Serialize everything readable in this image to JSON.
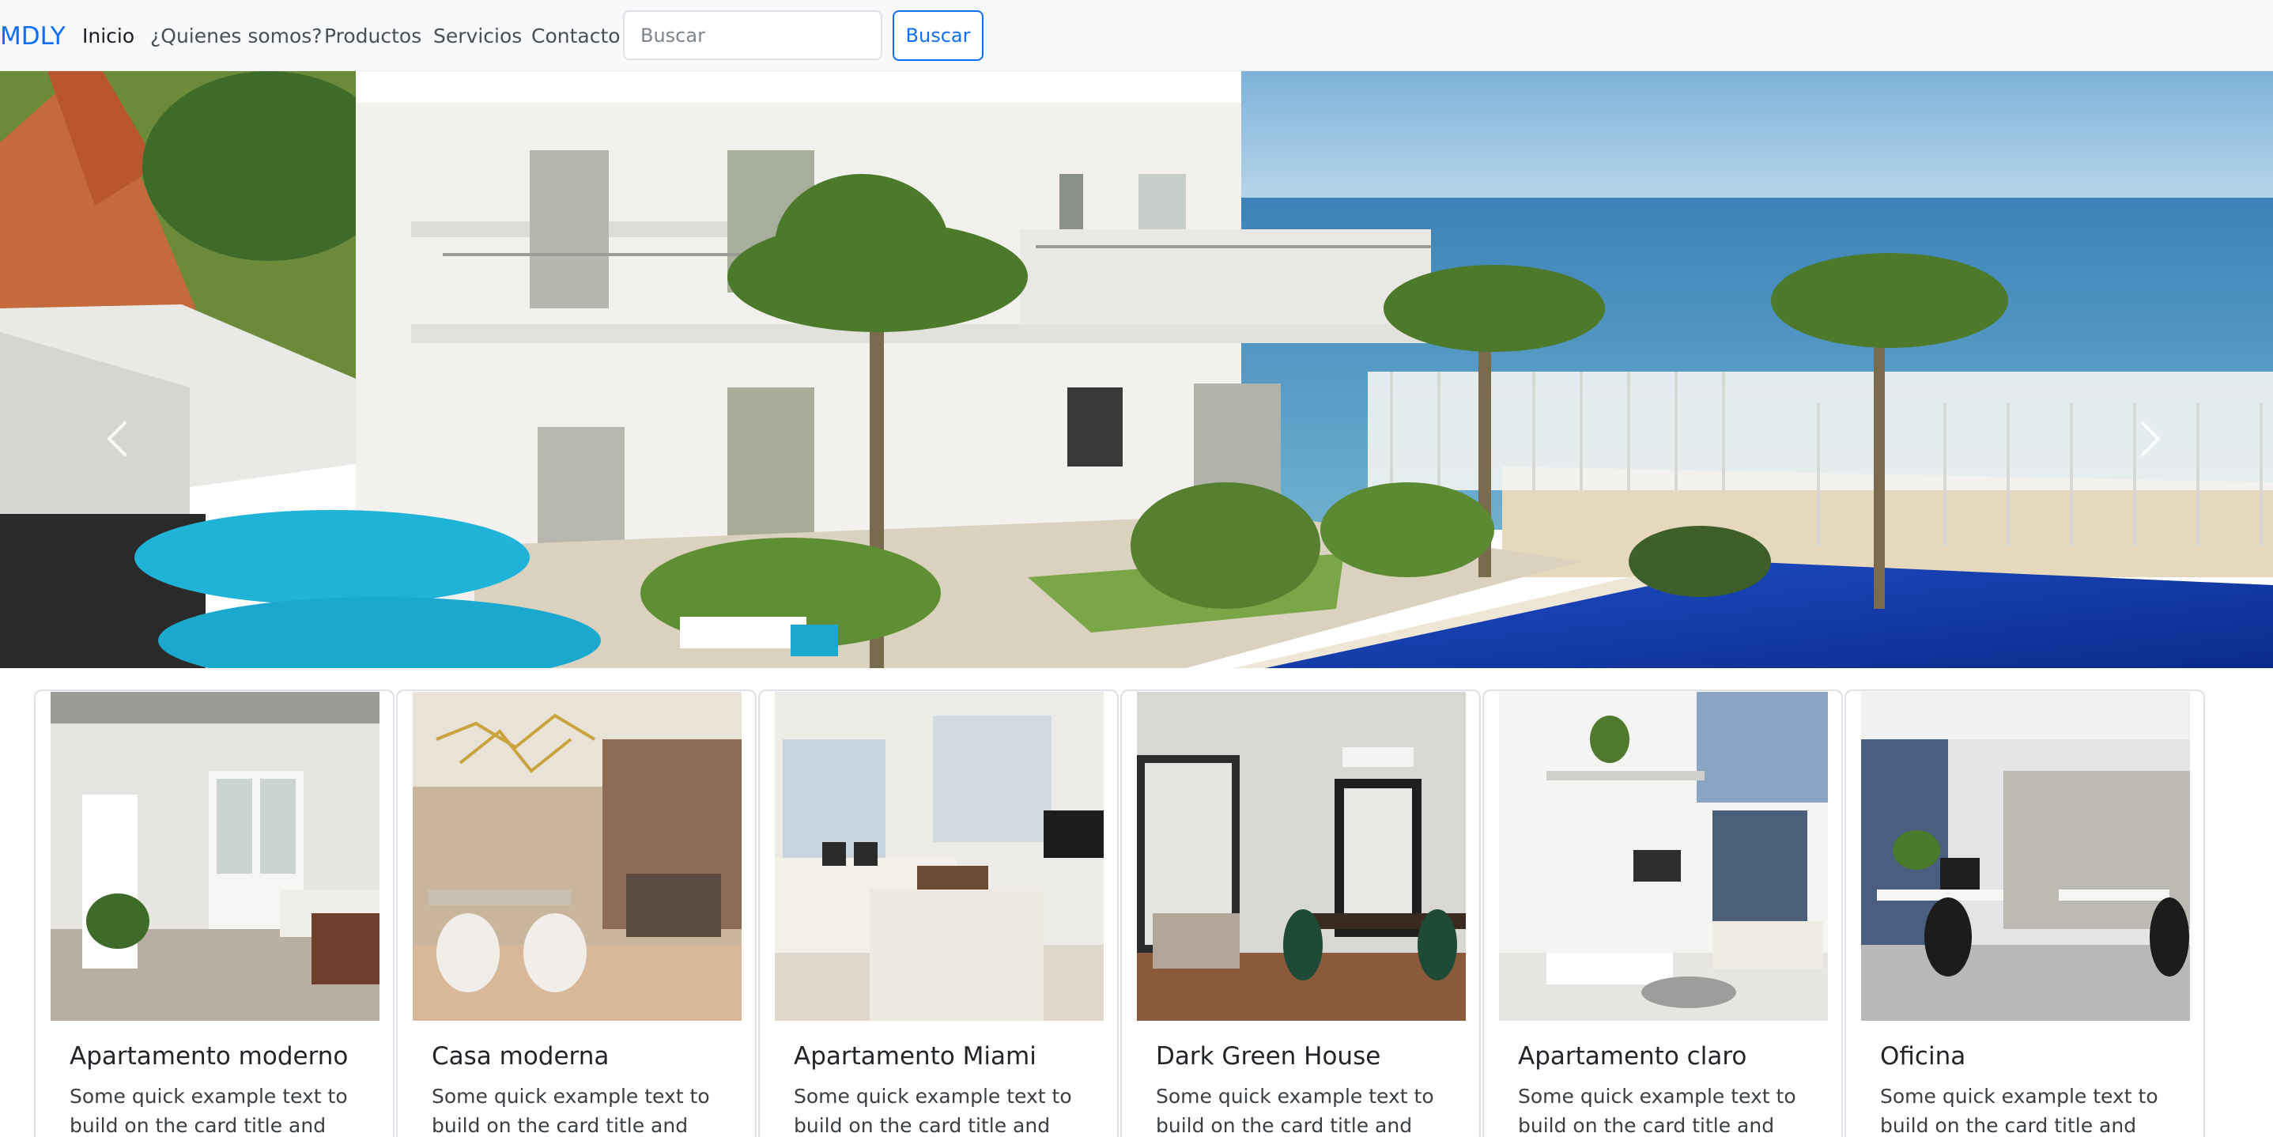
{
  "navbar": {
    "brand": "MDLY",
    "links": [
      {
        "label": "Inicio",
        "active": true
      },
      {
        "label": "¿Quienes somos?"
      },
      {
        "label": "Productos"
      },
      {
        "label": "Servicios"
      },
      {
        "label": "Contacto"
      }
    ],
    "search": {
      "placeholder": "Buscar",
      "value": "",
      "button_label": "Buscar"
    }
  },
  "carousel": {
    "prev_icon": "chevron-left-icon",
    "next_icon": "chevron-right-icon"
  },
  "cards": [
    {
      "title": "Apartamento moderno",
      "text": "Some quick example text to build on the card title and make"
    },
    {
      "title": "Casa moderna",
      "text": "Some quick example text to build on the card title and make"
    },
    {
      "title": "Apartamento Miami",
      "text": "Some quick example text to build on the card title and make"
    },
    {
      "title": "Dark Green House",
      "text": "Some quick example text to build on the card title and make"
    },
    {
      "title": "Apartamento claro",
      "text": "Some quick example text to build on the card title and make"
    },
    {
      "title": "Oficina",
      "text": "Some quick example text to build on the card title and make"
    }
  ],
  "colors": {
    "accent": "#0d6efd",
    "navbar_bg": "#f8f9fa",
    "card_border": "#dee2e6"
  }
}
